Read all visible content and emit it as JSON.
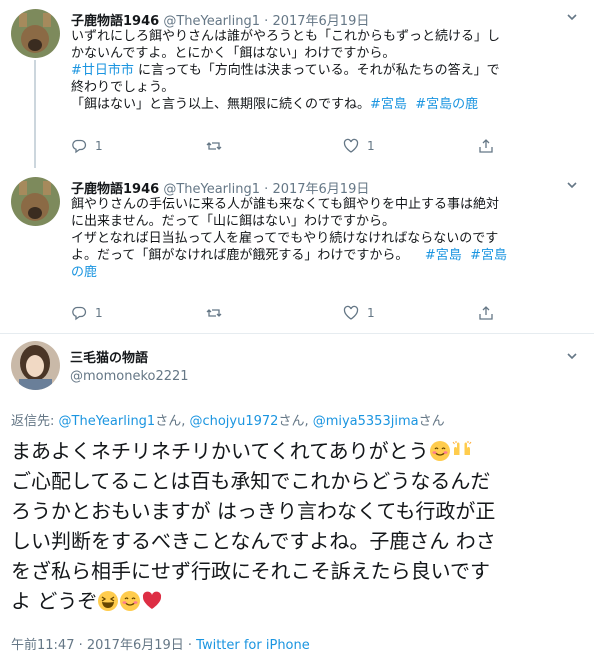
{
  "tweets": [
    {
      "name": "子鹿物語1946",
      "handle": "@TheYearling1",
      "dot": "·",
      "date": "2017年6月19日",
      "lines": [
        "いずれにしろ餌やりさんは誰がやろうとも「これからもずっと続ける」し",
        "かないんですよ。とにかく「餌はない」わけですから。",
        "に言っても「方向性は決まっている。それが私たちの答え」で",
        "終わりでしょう。",
        "「餌はない」と言う以上、無期限に続くのですね。"
      ],
      "tags": [
        "#廿日市市",
        "#宮島",
        "#宮島の鹿"
      ],
      "reply_count": "1",
      "like_count": "1"
    },
    {
      "name": "子鹿物語1946",
      "handle": "@TheYearling1",
      "dot": "·",
      "date": "2017年6月19日",
      "lines": [
        "餌やりさんの手伝いに来る人が誰も来なくても餌やりを中止する事は絶対",
        "に出来ません。だって「山に餌はない」わけですから。",
        "イザとなれば日当払って人を雇ってでもやり続けなければならないのです",
        "よ。だって「餌がなければ鹿が餓死する」わけですから。",
        "の鹿"
      ],
      "tags": [
        "#宮島",
        "#宮島"
      ],
      "reply_count": "1",
      "like_count": "1"
    }
  ],
  "main": {
    "name": "三毛猫の物語",
    "handle": "@momoneko2221",
    "replying_prefix": "返信先: ",
    "replying_links": [
      "@TheYearling1",
      "@chojyu1972",
      "@miya5353jima"
    ],
    "replying_suffix": "さん",
    "replying_sep": "さん, ",
    "text_lines": [
      "まあよくネチリネチリかいてくれてありがとう",
      "ご心配してることは百も承知でこれからどうなるんだ",
      "ろうかとおもいますが  はっきり言わなくても行政が正",
      "しい判断をするべきことなんですよね。子鹿さん  わさ",
      "をざ私ら相手にせず行政にそれこそ訴えたら良いです",
      "よ  どうぞ"
    ],
    "time": "午前11:47 · 2017年6月19日 · ",
    "source": "Twitter for iPhone"
  },
  "icons": [
    "reply-icon",
    "retweet-icon",
    "like-icon",
    "share-icon",
    "chevron-down-icon"
  ],
  "colors": {
    "link": "#1b95e0",
    "muted": "#657786",
    "divider": "#e6ecf0"
  }
}
